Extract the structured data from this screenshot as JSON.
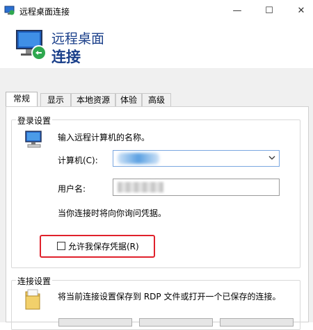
{
  "window": {
    "title": "远程桌面连接",
    "controls": {
      "minimize": "—",
      "maximize": "☐",
      "close": "✕"
    }
  },
  "banner": {
    "line1": "远程桌面",
    "line2": "连接"
  },
  "tabs": [
    {
      "label": "常规",
      "active": true
    },
    {
      "label": "显示",
      "active": false
    },
    {
      "label": "本地资源",
      "active": false
    },
    {
      "label": "体验",
      "active": false
    },
    {
      "label": "高级",
      "active": false
    }
  ],
  "login_settings": {
    "group_label": "登录设置",
    "prompt": "输入远程计算机的名称。",
    "computer_label": "计算机(C):",
    "username_label": "用户名:",
    "credentials_note": "当你连接时将向你询问凭据。",
    "allow_save_label": "允许我保存凭据(R)",
    "allow_save_checked": false
  },
  "connection_settings": {
    "group_label": "连接设置",
    "description": "将当前连接设置保存到 RDP 文件或打开一个已保存的连接。"
  },
  "colors": {
    "title_blue": "#1a3f8a",
    "highlight_red": "#e0212b",
    "focus_blue": "#7aa7e0"
  }
}
